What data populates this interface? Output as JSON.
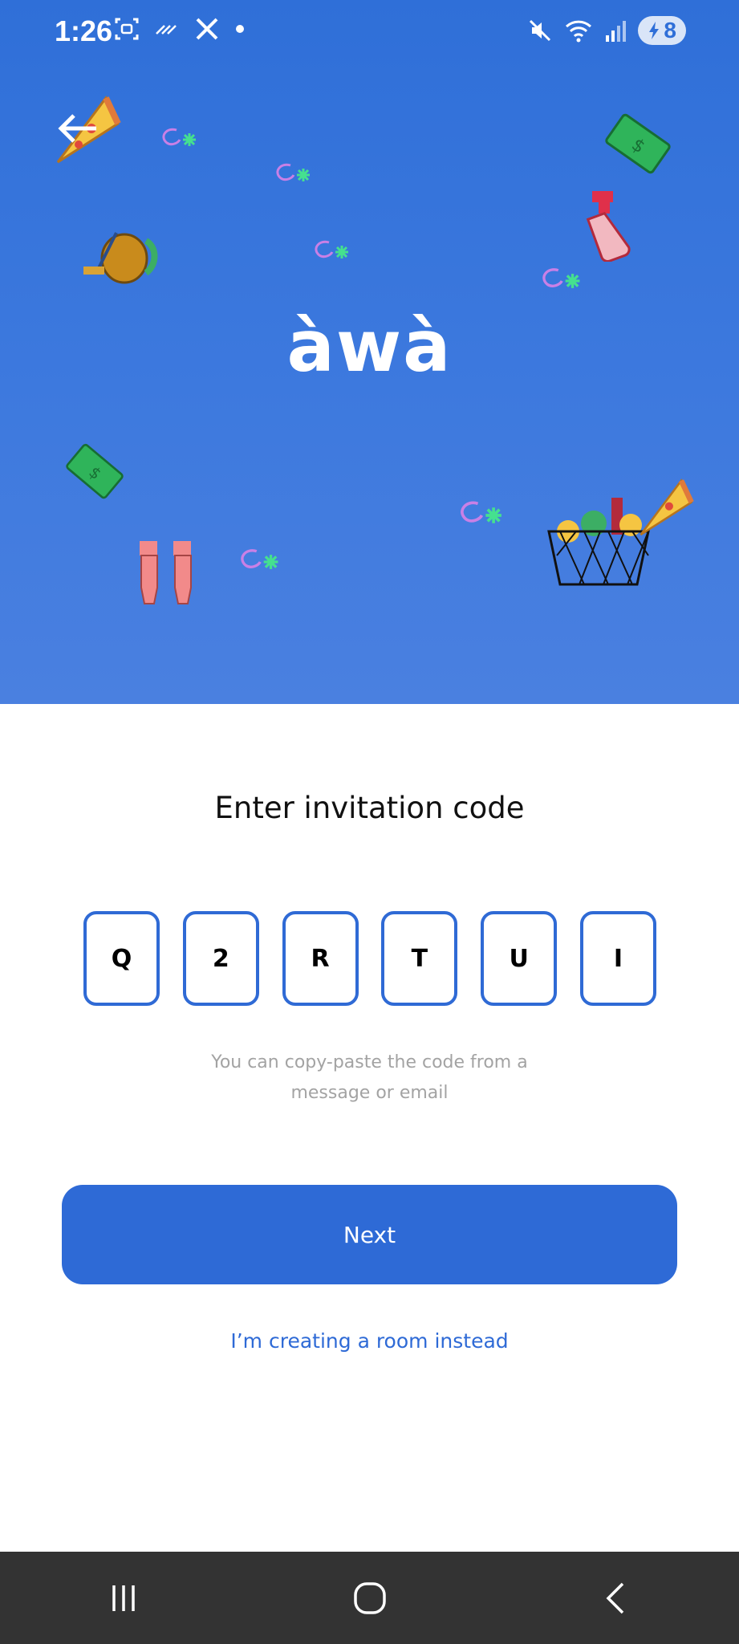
{
  "status_bar": {
    "time": "1:26",
    "battery_level": "8"
  },
  "header": {
    "logo_text": "àwà"
  },
  "form": {
    "title": "Enter invitation code",
    "code_chars": [
      "Q",
      "2",
      "R",
      "T",
      "U",
      "I"
    ],
    "hint": "You can copy-paste the code from a message or email",
    "next_label": "Next",
    "alt_link_label": "I’m creating a room instead"
  },
  "colors": {
    "hero_blue": "#2f6fd8",
    "accent_blue": "#2e6ad6",
    "nav_bar": "#333333"
  }
}
